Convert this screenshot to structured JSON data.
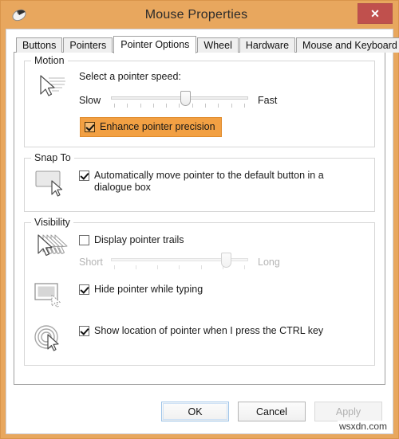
{
  "window": {
    "title": "Mouse Properties",
    "icon": "mouse-icon",
    "close_label": "✕",
    "frame_color": "#e8a75e",
    "close_color": "#c0504d"
  },
  "tabs": [
    {
      "label": "Buttons",
      "active": false
    },
    {
      "label": "Pointers",
      "active": false
    },
    {
      "label": "Pointer Options",
      "active": true
    },
    {
      "label": "Wheel",
      "active": false
    },
    {
      "label": "Hardware",
      "active": false
    },
    {
      "label": "Mouse and Keyboard Center",
      "active": false
    }
  ],
  "groups": {
    "motion": {
      "title": "Motion",
      "icon": "pointer-speed-icon",
      "speed_label": "Select a pointer speed:",
      "slider": {
        "min_label": "Slow",
        "max_label": "Fast",
        "value_percent": 55,
        "tick_count": 11,
        "disabled": false
      },
      "enhance": {
        "label": "Enhance pointer precision",
        "checked": true,
        "highlighted": true,
        "highlight_color": "#f2a043"
      }
    },
    "snap_to": {
      "title": "Snap To",
      "icon": "snap-to-button-icon",
      "auto_move": {
        "label": "Automatically move pointer to the default button in a dialogue box",
        "checked": true
      }
    },
    "visibility": {
      "title": "Visibility",
      "trails": {
        "icon": "pointer-trails-icon",
        "label": "Display pointer trails",
        "checked": false,
        "slider": {
          "min_label": "Short",
          "max_label": "Long",
          "value_percent": 87,
          "tick_count": 7,
          "disabled": true
        }
      },
      "hide_typing": {
        "icon": "hide-pointer-typing-icon",
        "label": "Hide pointer while typing",
        "checked": true
      },
      "show_location": {
        "icon": "show-pointer-location-icon",
        "label": "Show location of pointer when I press the CTRL key",
        "checked": true
      }
    }
  },
  "buttons": {
    "ok": "OK",
    "cancel": "Cancel",
    "apply": "Apply",
    "apply_disabled": true
  },
  "watermark": "wsxdn.com"
}
